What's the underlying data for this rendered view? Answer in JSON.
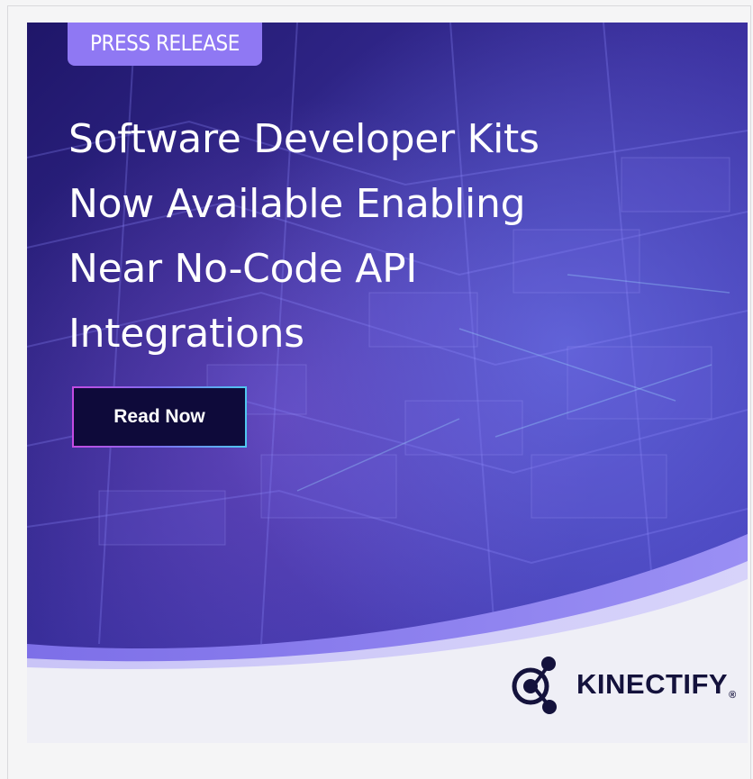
{
  "badge": {
    "label": "PRESS RELEASE"
  },
  "headline": {
    "lines": [
      "Software Developer Kits",
      "Now Available Enabling",
      "Near No-Code API",
      "Integrations"
    ]
  },
  "cta": {
    "label": "Read Now"
  },
  "brand": {
    "name": "KINECTIFY",
    "reg_mark": "®",
    "icon": "kinectify-molecule-icon"
  },
  "colors": {
    "hero_dark": "#1f1669",
    "hero_mid": "#3d35b0",
    "badge": "#8f78f3",
    "cta_bg": "#0e0a3a",
    "wave_light": "#c9c4f7",
    "wave_mid": "#8f84f0",
    "footer_bg": "#efeff6",
    "brand_text": "#14123c"
  }
}
